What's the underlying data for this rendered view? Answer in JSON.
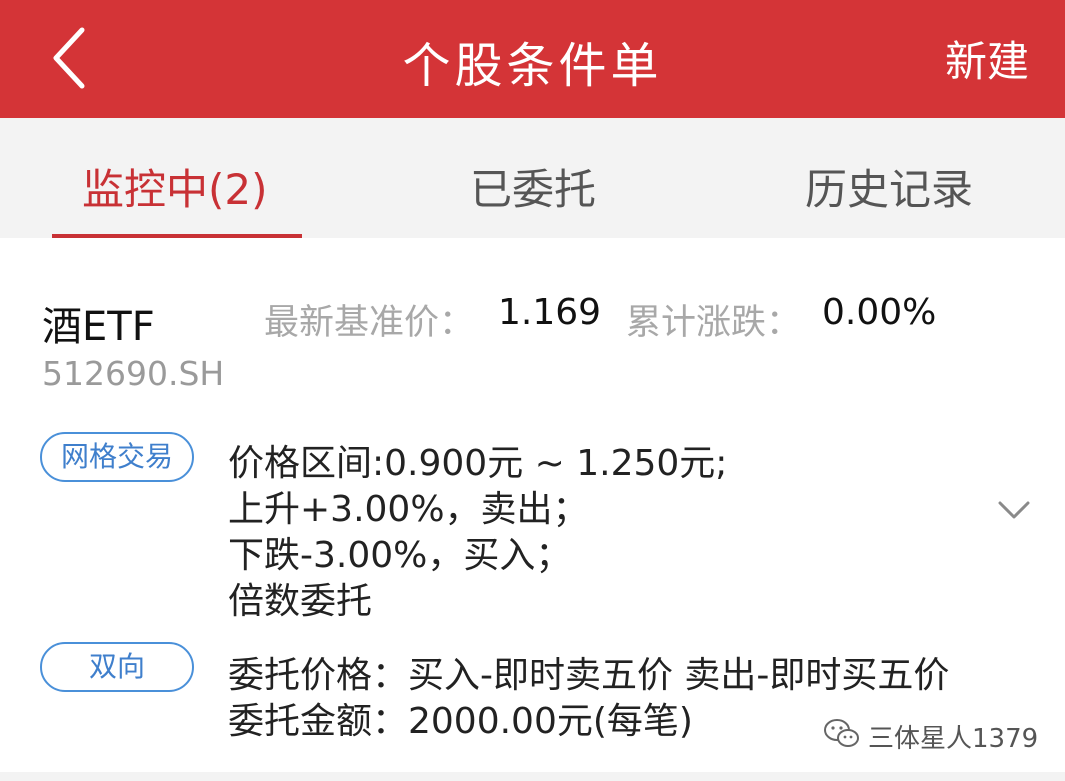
{
  "header": {
    "title": "个股条件单",
    "new_label": "新建",
    "back_icon": "chevron-left-icon",
    "color": "#d43437"
  },
  "tabs": [
    {
      "label": "监控中(2)",
      "active": true
    },
    {
      "label": "已委托",
      "active": false
    },
    {
      "label": "历史记录",
      "active": false
    }
  ],
  "accent_color": "#c83135",
  "stock": {
    "name": "酒ETF",
    "code": "512690.SH",
    "price_label": "最新基准价：",
    "price_value": "1.169",
    "change_label": "累计涨跌：",
    "change_value": "0.00%"
  },
  "condition": {
    "tag": "网格交易",
    "lines": [
      "价格区间:0.900元 ~ 1.250元;",
      "上升+3.00%，卖出；",
      "下跌-3.00%，买入；",
      "倍数委托"
    ],
    "expand_icon": "chevron-down-icon"
  },
  "order": {
    "tag": "双向",
    "price_line": "委托价格：买入-即时卖五价 卖出-即时买五价",
    "amount_line": "委托金额：2000.00元(每笔)"
  },
  "watermark": {
    "icon": "wechat-icon",
    "text": "三体星人1379"
  }
}
